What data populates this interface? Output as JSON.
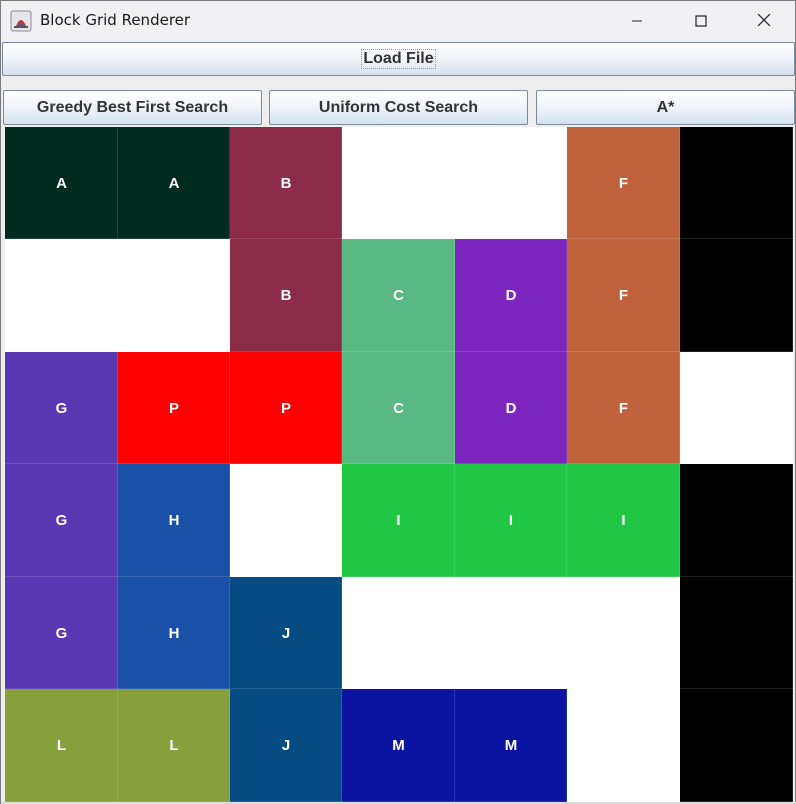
{
  "window": {
    "title": "Block Grid Renderer",
    "controls": {
      "minimize": "minimize-icon",
      "maximize": "maximize-icon",
      "close": "close-icon"
    }
  },
  "toolbar": {
    "load_label": "Load File",
    "algorithms": [
      {
        "label": "Greedy Best First Search"
      },
      {
        "label": "Uniform Cost Search"
      },
      {
        "label": "A*"
      }
    ]
  },
  "grid": {
    "rows": 6,
    "cols": 7,
    "cells": [
      [
        {
          "label": "A",
          "color": "#022b1f"
        },
        {
          "label": "A",
          "color": "#022b1f"
        },
        {
          "label": "B",
          "color": "#8c2b47"
        },
        {
          "label": "",
          "color": "#ffffff"
        },
        {
          "label": "",
          "color": "#ffffff"
        },
        {
          "label": "F",
          "color": "#c0633d"
        },
        {
          "label": "",
          "color": "#000000"
        }
      ],
      [
        {
          "label": "",
          "color": "#ffffff"
        },
        {
          "label": "",
          "color": "#ffffff"
        },
        {
          "label": "B",
          "color": "#8c2b47"
        },
        {
          "label": "C",
          "color": "#5ab982"
        },
        {
          "label": "D",
          "color": "#7c26bf"
        },
        {
          "label": "F",
          "color": "#c0633d"
        },
        {
          "label": "",
          "color": "#000000"
        }
      ],
      [
        {
          "label": "G",
          "color": "#5939b3"
        },
        {
          "label": "P",
          "color": "#ff0000"
        },
        {
          "label": "P",
          "color": "#ff0000"
        },
        {
          "label": "C",
          "color": "#5ab982"
        },
        {
          "label": "D",
          "color": "#7c26bf"
        },
        {
          "label": "F",
          "color": "#c0633d"
        },
        {
          "label": "",
          "color": "#ffffff"
        }
      ],
      [
        {
          "label": "G",
          "color": "#5939b3"
        },
        {
          "label": "H",
          "color": "#1a50a8"
        },
        {
          "label": "",
          "color": "#ffffff"
        },
        {
          "label": "I",
          "color": "#20c644"
        },
        {
          "label": "I",
          "color": "#20c644"
        },
        {
          "label": "I",
          "color": "#20c644"
        },
        {
          "label": "",
          "color": "#000000"
        }
      ],
      [
        {
          "label": "G",
          "color": "#5939b3"
        },
        {
          "label": "H",
          "color": "#1a50a8"
        },
        {
          "label": "J",
          "color": "#064b82"
        },
        {
          "label": "",
          "color": "#ffffff"
        },
        {
          "label": "",
          "color": "#ffffff"
        },
        {
          "label": "",
          "color": "#ffffff"
        },
        {
          "label": "",
          "color": "#000000"
        }
      ],
      [
        {
          "label": "L",
          "color": "#88a03c"
        },
        {
          "label": "L",
          "color": "#88a03c"
        },
        {
          "label": "J",
          "color": "#064b82"
        },
        {
          "label": "M",
          "color": "#0a14a0"
        },
        {
          "label": "M",
          "color": "#0a14a0"
        },
        {
          "label": "",
          "color": "#ffffff"
        },
        {
          "label": "",
          "color": "#000000"
        }
      ]
    ]
  }
}
